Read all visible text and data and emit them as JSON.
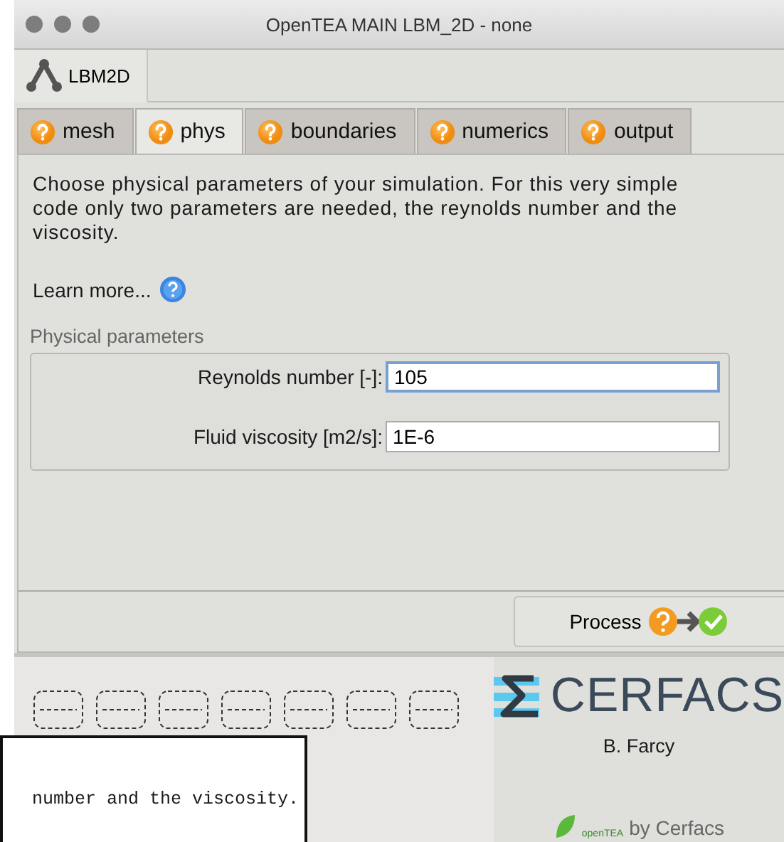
{
  "window": {
    "title": "OpenTEA MAIN  LBM_2D  -  none"
  },
  "project_tabs": [
    {
      "label": "LBM2D",
      "selected": true
    }
  ],
  "tabs": [
    {
      "label": "mesh",
      "selected": false
    },
    {
      "label": "phys",
      "selected": true
    },
    {
      "label": "boundaries",
      "selected": false
    },
    {
      "label": "numerics",
      "selected": false
    },
    {
      "label": "output",
      "selected": false
    }
  ],
  "description": "Choose physical parameters of your simulation.  For this very simple code only two parameters are needed, the reynolds number and the viscosity.",
  "learn_more": "Learn more...",
  "group": {
    "title": "Physical parameters",
    "fields": [
      {
        "label": "Reynolds number [-]:",
        "value": "105",
        "focused": true
      },
      {
        "label": "Fluid viscosity [m2/s]:",
        "value": "1E-6",
        "focused": false
      }
    ]
  },
  "process_button": "Process",
  "footer": {
    "brand": "CERFACS",
    "author": "B. Farcy",
    "credit": "by Cerfacs",
    "small_logo": "openTEA"
  },
  "tooltip": "number and the viscosity."
}
